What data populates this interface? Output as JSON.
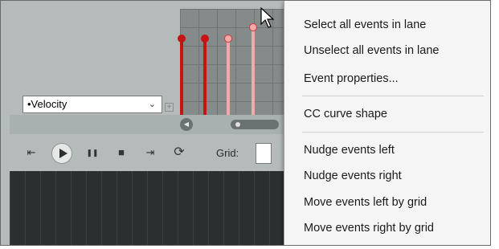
{
  "lane": {
    "selected_lane": "•Velocity",
    "chevron_icon": "chevron-down-icon",
    "add_lane_icon": "plus-box-icon"
  },
  "velocity_markers": [
    {
      "style": "dark"
    },
    {
      "style": "dark"
    },
    {
      "style": "light"
    },
    {
      "style": "light"
    }
  ],
  "transport": {
    "buttons": [
      {
        "name": "go-to-start-button",
        "icon": "skip-to-start-icon",
        "glyph": "⇤"
      },
      {
        "name": "play-button",
        "icon": "play-icon",
        "glyph": ""
      },
      {
        "name": "pause-button",
        "icon": "pause-icon",
        "glyph": "❚❚"
      },
      {
        "name": "stop-button",
        "icon": "stop-icon",
        "glyph": "■"
      },
      {
        "name": "go-to-end-button",
        "icon": "skip-to-end-icon",
        "glyph": "⇥"
      },
      {
        "name": "loop-button",
        "icon": "loop-icon",
        "glyph": "⟳"
      }
    ],
    "grid_label": "Grid:"
  },
  "context_menu": {
    "groups": [
      [
        "Select all events in lane",
        "Unselect all events in lane",
        "Event properties..."
      ],
      [
        "CC curve shape"
      ],
      [
        "Nudge events left",
        "Nudge events right",
        "Move events left by grid",
        "Move events right by grid"
      ]
    ]
  },
  "colors": {
    "velocity_dark": "#c41515",
    "velocity_light": "#f4a8a8",
    "panel_bg": "#b4bbba",
    "menu_bg": "#f5f5f5"
  }
}
